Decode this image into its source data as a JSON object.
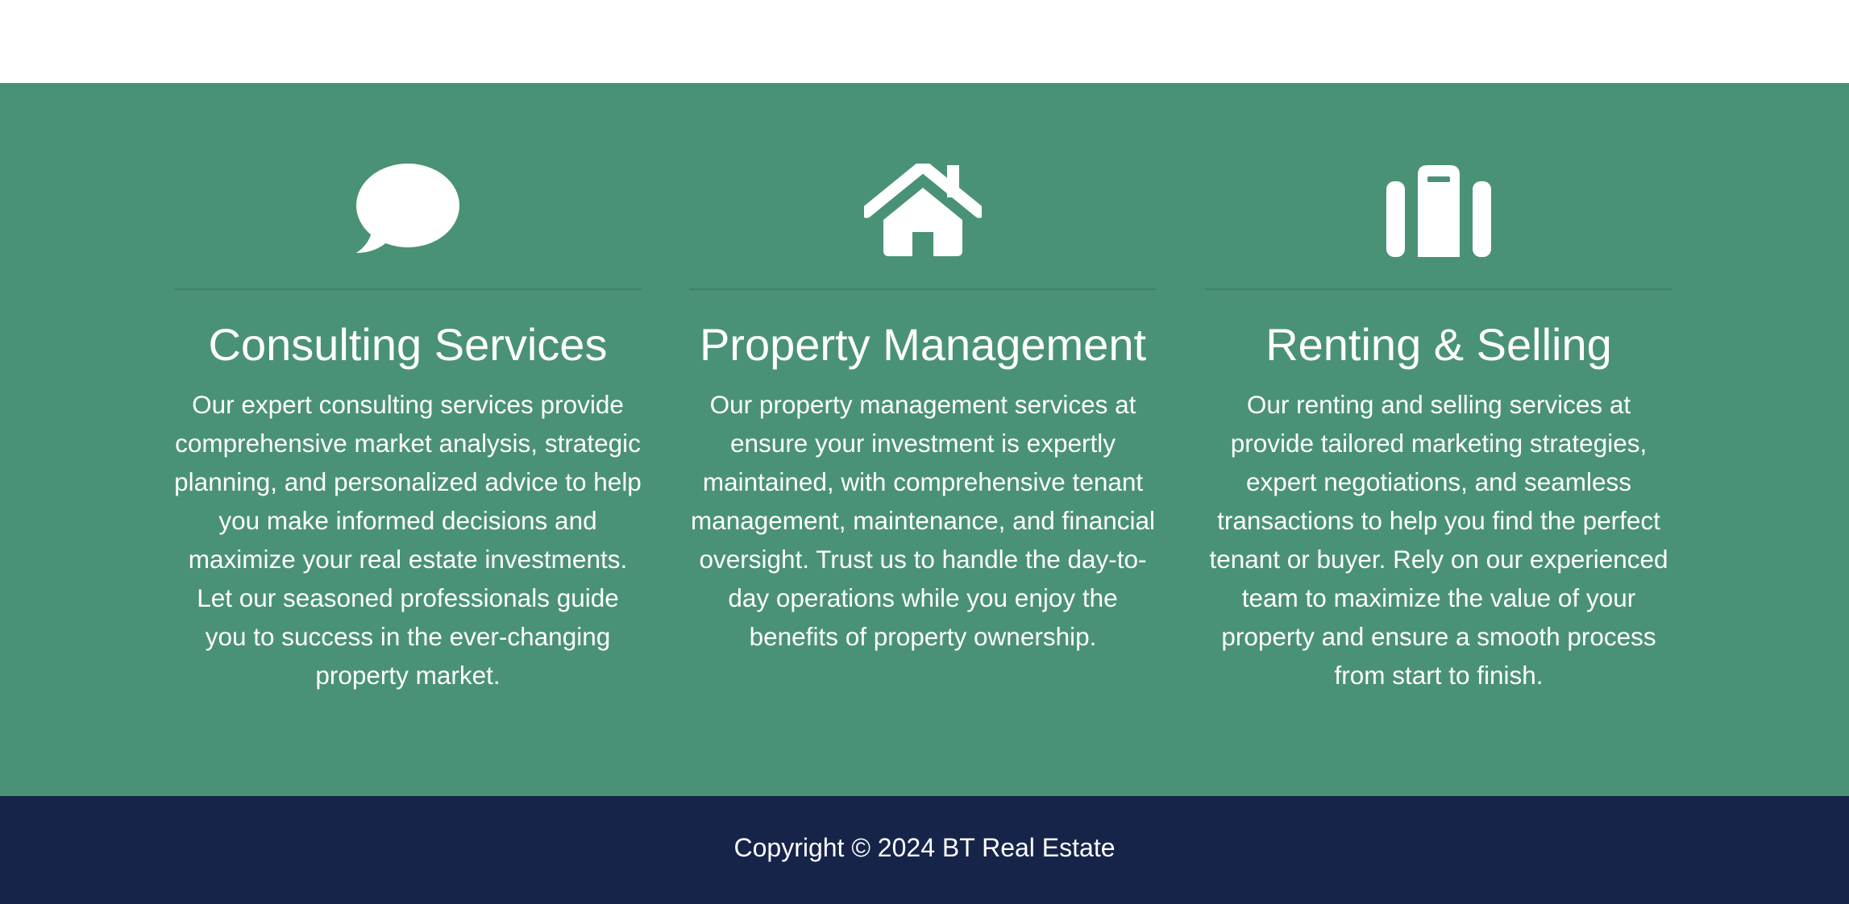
{
  "colors": {
    "services_background": "#4a9276",
    "footer_background": "#17244a",
    "text": "#ffffff"
  },
  "services": [
    {
      "icon": "chat-bubble-icon",
      "title": "Consulting Services",
      "text": "Our expert consulting services provide comprehensive market analysis, strategic planning, and personalized advice to help you make informed decisions and maximize your real estate investments. Let our seasoned professionals guide you to success in the ever-changing property market."
    },
    {
      "icon": "house-icon",
      "title": "Property Management",
      "text": "Our property management services at ensure your investment is expertly maintained, with comprehensive tenant management, maintenance, and financial oversight. Trust us to handle the day-to-day operations while you enjoy the benefits of property ownership."
    },
    {
      "icon": "suitcase-icon",
      "title": "Renting & Selling",
      "text": "Our renting and selling services at provide tailored marketing strategies, expert negotiations, and seamless transactions to help you find the perfect tenant or buyer. Rely on our experienced team to maximize the value of your property and ensure a smooth process from start to finish."
    }
  ],
  "footer": {
    "copyright": "Copyright © 2024 BT Real Estate"
  }
}
